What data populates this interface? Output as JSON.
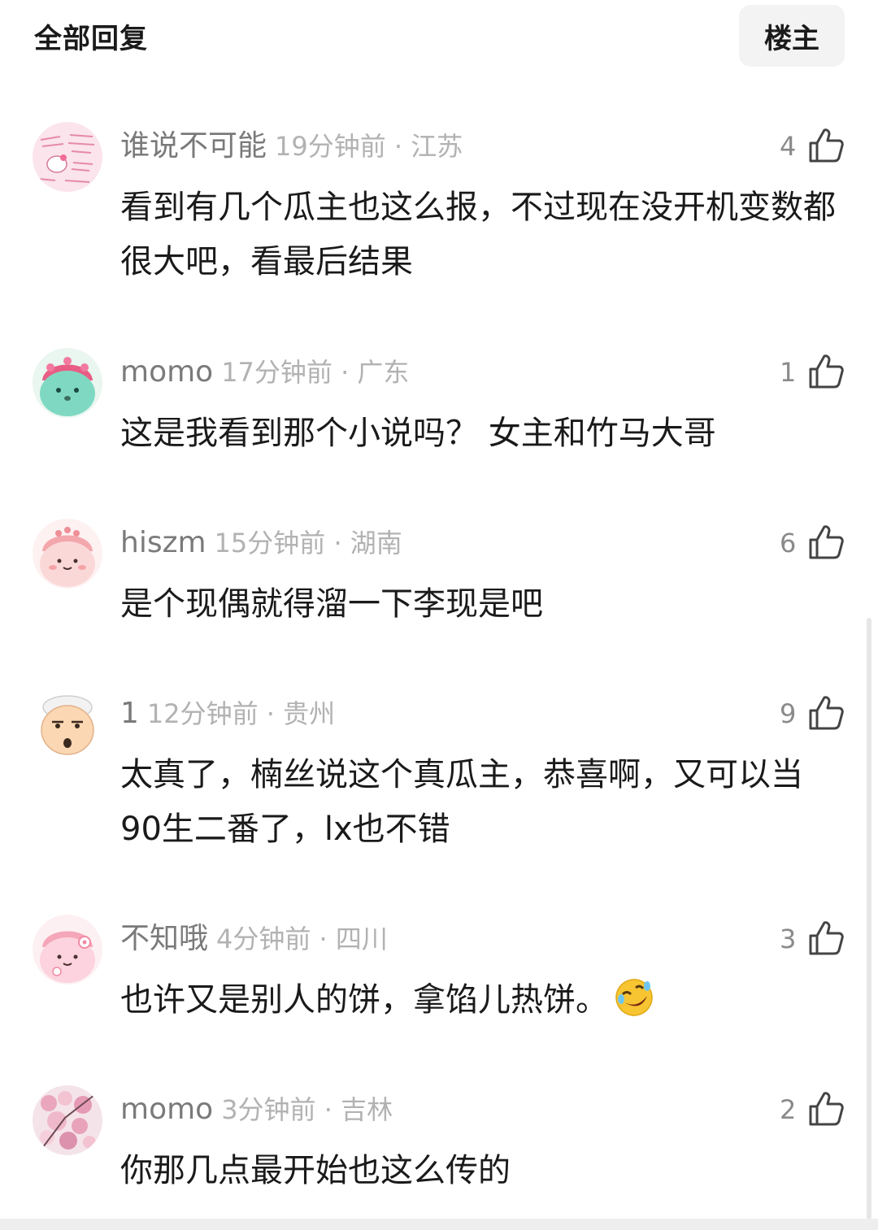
{
  "header": {
    "title": "全部回复",
    "filter_button": "楼主"
  },
  "comments": [
    {
      "username": "谁说不可能",
      "time_location": "19分钟前 · 江苏",
      "likes": "4",
      "content": "看到有几个瓜主也这么报，不过现在没开机变数都很大吧，看最后结果"
    },
    {
      "username": "momo",
      "time_location": "17分钟前 · 广东",
      "likes": "1",
      "content": "这是我看到那个小说吗？ 女主和竹马大哥"
    },
    {
      "username": "hiszm",
      "time_location": "15分钟前 · 湖南",
      "likes": "6",
      "content": "是个现偶就得溜一下李现是吧"
    },
    {
      "username": "1",
      "time_location": "12分钟前 · 贵州",
      "likes": "9",
      "content": "太真了，楠丝说这个真瓜主，恭喜啊，又可以当90生二番了，lx也不错"
    },
    {
      "username": "不知哦",
      "time_location": "4分钟前 · 四川",
      "likes": "3",
      "content": "也许又是别人的饼，拿馅儿热饼。"
    },
    {
      "username": "momo",
      "time_location": "3分钟前 · 吉林",
      "likes": "2",
      "content": "你那几点最开始也这么传的"
    }
  ],
  "colors": {
    "username": "#7a7a7a",
    "meta": "#b2b2b2",
    "text": "#1a1a1a",
    "filter_bg": "#f3f3f3"
  },
  "icons": {
    "like": "thumbs-up-icon",
    "emoji": "rofl-emoji-icon"
  }
}
